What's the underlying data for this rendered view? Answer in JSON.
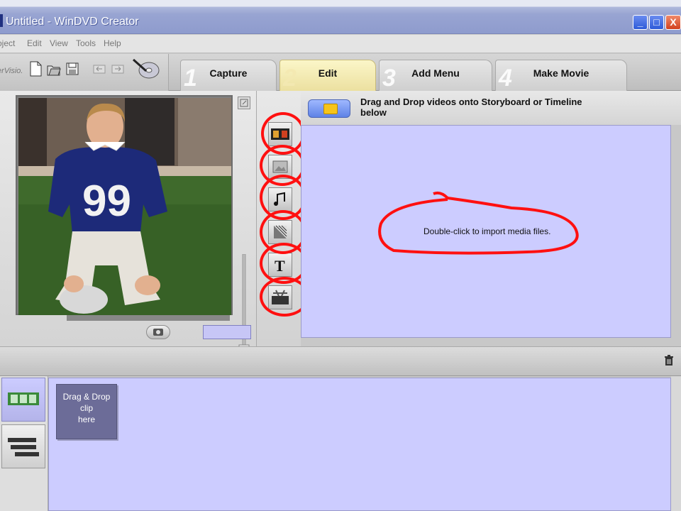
{
  "window": {
    "title": "Untitled - WinDVD Creator",
    "controls": {
      "minimize": "_",
      "maximize": "□",
      "close": "X"
    }
  },
  "menu": [
    "oject",
    "Edit",
    "View",
    "Tools",
    "Help"
  ],
  "toolbar": {
    "brand": "erVisio."
  },
  "tabs": [
    {
      "num": "1",
      "label": "Capture",
      "active": false
    },
    {
      "num": "2",
      "label": "Edit",
      "active": true
    },
    {
      "num": "3",
      "label": "Add Menu",
      "active": false
    },
    {
      "num": "4",
      "label": "Make Movie",
      "active": false
    }
  ],
  "library": {
    "hint": "Drag and Drop videos onto Storyboard or Timeline below",
    "import_hint": "Double-click to import media files."
  },
  "storyboard": {
    "clip_placeholder": "Drag & Drop\nclip\nhere"
  },
  "media_categories": [
    "video-clips",
    "images",
    "audio",
    "transitions",
    "titles",
    "effects"
  ],
  "colors": {
    "panel_blue": "#ccccff",
    "annotation_red": "#ff1010",
    "clip_slot": "#6c6c98"
  }
}
